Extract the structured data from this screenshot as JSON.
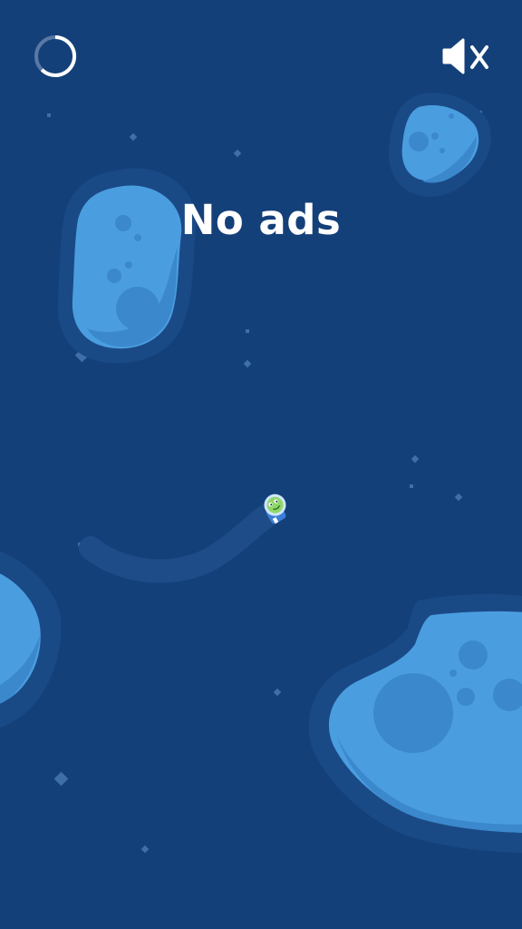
{
  "banner": {
    "text": "No ads"
  },
  "controls": {
    "loader_icon": "loading-ring-icon",
    "sound_icon": "speaker-muted-icon",
    "sound_state": "muted"
  },
  "character": {
    "icon": "alien-astronaut-icon"
  },
  "colors": {
    "background": "#14407a",
    "asteroid_fill": "#4a9ee0",
    "asteroid_shadow": "#3b88cc",
    "asteroid_halo": "#1a4a86",
    "trail": "#1d4c88",
    "text": "#ffffff",
    "alien_green": "#8ed86a"
  }
}
